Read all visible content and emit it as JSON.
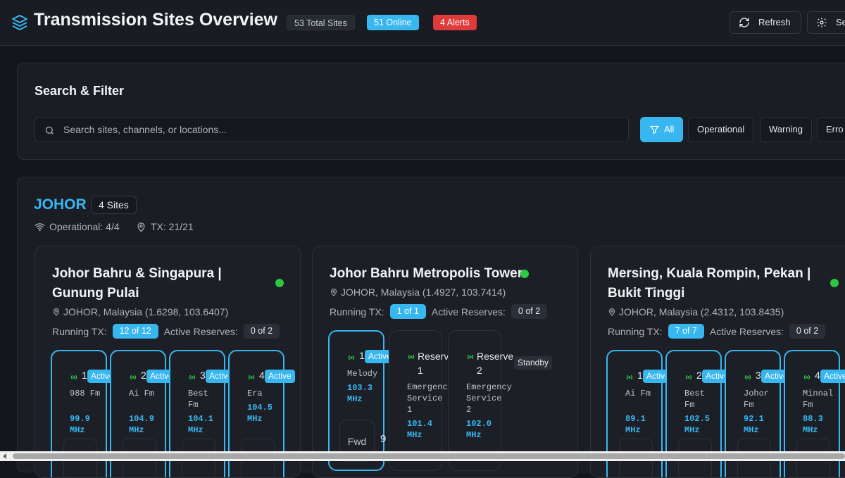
{
  "header": {
    "title": "Transmission Sites Overview",
    "total_badge": "53 Total Sites",
    "online_badge": "51 Online",
    "alerts_badge": "4 Alerts",
    "refresh_label": "Refresh",
    "settings_label": "Se",
    "logo_icon": "layers-icon"
  },
  "search": {
    "heading": "Search & Filter",
    "placeholder": "Search sites, channels, or locations...",
    "value": "",
    "filters": [
      {
        "label": "All",
        "active": true
      },
      {
        "label": "Operational",
        "active": false
      },
      {
        "label": "Warning",
        "active": false
      },
      {
        "label": "Erro",
        "active": false
      }
    ]
  },
  "region": {
    "name": "JOHOR",
    "sites_badge": "4 Sites",
    "operational": "Operational: 4/4",
    "tx": "TX: 21/21"
  },
  "sites": [
    {
      "name": "Johor Bahru & Singapura | Gunung Pulai",
      "location": "JOHOR, Malaysia (1.6298, 103.6407)",
      "running_label": "Running TX:",
      "running": "12 of 12",
      "reserves_label": "Active Reserves:",
      "reserves": "0 of 2",
      "transmitters": [
        {
          "num": "1",
          "status": "Active",
          "channel": "988 Fm",
          "freq": "99.9 MHz"
        },
        {
          "num": "2",
          "status": "Active",
          "channel": "Ai Fm",
          "freq": "104.9 MHz"
        },
        {
          "num": "3",
          "status": "Active",
          "channel": "Best Fm",
          "freq": "104.1 MHz"
        },
        {
          "num": "4",
          "status": "Active",
          "channel": "Era",
          "freq": "104.5 MHz"
        }
      ]
    },
    {
      "name": "Johor Bahru Metropolis Tower",
      "location": "JOHOR, Malaysia (1.4927, 103.7414)",
      "running_label": "Running TX:",
      "running": "1 of 1",
      "reserves_label": "Active Reserves:",
      "reserves": "0 of 2",
      "transmitters": [
        {
          "num": "1",
          "status": "Active",
          "channel": "Melody",
          "freq": "103.3 MHz",
          "fwd": "Fwd",
          "extra": "9"
        }
      ],
      "reserves_list": [
        {
          "label": "Reserve 1",
          "channel": "Emergency Service 1",
          "freq": "101.4 MHz"
        },
        {
          "label": "Reserve 2",
          "channel": "Emergency Service 2",
          "freq": "102.0 MHz",
          "status": "Standby"
        }
      ]
    },
    {
      "name": "Mersing, Kuala Rompin, Pekan | Bukit Tinggi",
      "location": "JOHOR, Malaysia (2.4312, 103.8435)",
      "running_label": "Running TX:",
      "running": "7 of 7",
      "reserves_label": "Active Reserves:",
      "reserves": "0 of 2",
      "transmitters": [
        {
          "num": "1",
          "status": "Active",
          "channel": "Ai Fm",
          "freq": "89.1 MHz"
        },
        {
          "num": "2",
          "status": "Active",
          "channel": "Best Fm",
          "freq": "102.5 MHz"
        },
        {
          "num": "3",
          "status": "Active",
          "channel": "Johor Fm",
          "freq": "92.1 MHz"
        },
        {
          "num": "4",
          "status": "Active",
          "channel": "Minnal Fm",
          "freq": "88.3 MHz"
        }
      ]
    }
  ],
  "colors": {
    "accent": "#38b6f0",
    "online": "#2ec840",
    "alert": "#e03b3b",
    "background": "#13161c"
  }
}
